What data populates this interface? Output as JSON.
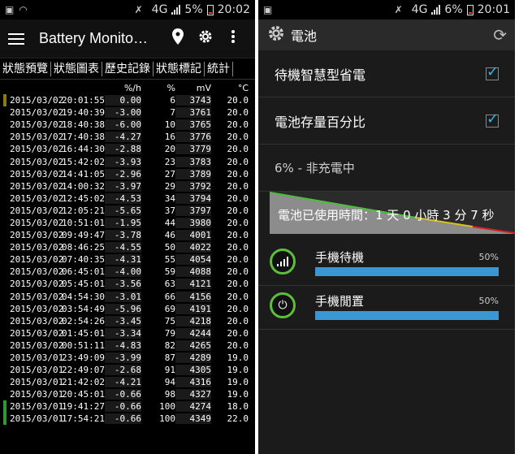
{
  "left": {
    "status": {
      "network": "4G",
      "battery": "5%",
      "time": "20:02"
    },
    "toolbar": {
      "title": "Battery Monito…"
    },
    "tabs": [
      "狀態預覽",
      "狀態圖表",
      "歷史記錄",
      "狀態標記",
      "統計"
    ],
    "columns": {
      "rate": "%/h",
      "pct": "%",
      "mv": "mV",
      "temp": "°C"
    },
    "rows": [
      {
        "date": "2015/03/02",
        "time": "20:01:55",
        "rate": "0.00",
        "pct": "6",
        "mv": "3743",
        "temp": "20.0",
        "mark": "#8a7a10"
      },
      {
        "date": "2015/03/02",
        "time": "19:40:39",
        "rate": "-3.00",
        "pct": "7",
        "mv": "3761",
        "temp": "20.0"
      },
      {
        "date": "2015/03/02",
        "time": "18:40:38",
        "rate": "-6.00",
        "pct": "10",
        "mv": "3765",
        "temp": "20.0"
      },
      {
        "date": "2015/03/02",
        "time": "17:40:38",
        "rate": "-4.27",
        "pct": "16",
        "mv": "3776",
        "temp": "20.0"
      },
      {
        "date": "2015/03/02",
        "time": "16:44:30",
        "rate": "-2.88",
        "pct": "20",
        "mv": "3779",
        "temp": "20.0"
      },
      {
        "date": "2015/03/02",
        "time": "15:42:02",
        "rate": "-3.93",
        "pct": "23",
        "mv": "3783",
        "temp": "20.0"
      },
      {
        "date": "2015/03/02",
        "time": "14:41:05",
        "rate": "-2.96",
        "pct": "27",
        "mv": "3789",
        "temp": "20.0"
      },
      {
        "date": "2015/03/02",
        "time": "14:00:32",
        "rate": "-3.97",
        "pct": "29",
        "mv": "3792",
        "temp": "20.0"
      },
      {
        "date": "2015/03/02",
        "time": "12:45:02",
        "rate": "-4.53",
        "pct": "34",
        "mv": "3794",
        "temp": "20.0"
      },
      {
        "date": "2015/03/02",
        "time": "12:05:21",
        "rate": "-5.65",
        "pct": "37",
        "mv": "3797",
        "temp": "20.0"
      },
      {
        "date": "2015/03/02",
        "time": "10:51:01",
        "rate": "-1.95",
        "pct": "44",
        "mv": "3980",
        "temp": "20.0"
      },
      {
        "date": "2015/03/02",
        "time": "09:49:47",
        "rate": "-3.78",
        "pct": "46",
        "mv": "4001",
        "temp": "20.0"
      },
      {
        "date": "2015/03/02",
        "time": "08:46:25",
        "rate": "-4.55",
        "pct": "50",
        "mv": "4022",
        "temp": "20.0"
      },
      {
        "date": "2015/03/02",
        "time": "07:40:35",
        "rate": "-4.31",
        "pct": "55",
        "mv": "4054",
        "temp": "20.0"
      },
      {
        "date": "2015/03/02",
        "time": "06:45:01",
        "rate": "-4.00",
        "pct": "59",
        "mv": "4088",
        "temp": "20.0"
      },
      {
        "date": "2015/03/02",
        "time": "05:45:01",
        "rate": "-3.56",
        "pct": "63",
        "mv": "4121",
        "temp": "20.0"
      },
      {
        "date": "2015/03/02",
        "time": "04:54:30",
        "rate": "-3.01",
        "pct": "66",
        "mv": "4156",
        "temp": "20.0"
      },
      {
        "date": "2015/03/02",
        "time": "03:54:49",
        "rate": "-5.96",
        "pct": "69",
        "mv": "4191",
        "temp": "20.0"
      },
      {
        "date": "2015/03/02",
        "time": "02:54:26",
        "rate": "-3.45",
        "pct": "75",
        "mv": "4218",
        "temp": "20.0"
      },
      {
        "date": "2015/03/02",
        "time": "01:45:01",
        "rate": "-3.34",
        "pct": "79",
        "mv": "4244",
        "temp": "20.0"
      },
      {
        "date": "2015/03/02",
        "time": "00:51:11",
        "rate": "-4.83",
        "pct": "82",
        "mv": "4265",
        "temp": "20.0"
      },
      {
        "date": "2015/03/01",
        "time": "23:49:09",
        "rate": "-3.99",
        "pct": "87",
        "mv": "4289",
        "temp": "19.0"
      },
      {
        "date": "2015/03/01",
        "time": "22:49:07",
        "rate": "-2.68",
        "pct": "91",
        "mv": "4305",
        "temp": "19.0"
      },
      {
        "date": "2015/03/01",
        "time": "21:42:02",
        "rate": "-4.21",
        "pct": "94",
        "mv": "4316",
        "temp": "19.0"
      },
      {
        "date": "2015/03/01",
        "time": "20:45:01",
        "rate": "-0.66",
        "pct": "98",
        "mv": "4327",
        "temp": "19.0"
      },
      {
        "date": "2015/03/01",
        "time": "19:41:27",
        "rate": "-0.66",
        "pct": "100",
        "mv": "4274",
        "temp": "18.0",
        "mark": "#2c9a2c"
      },
      {
        "date": "2015/03/01",
        "time": "17:54:21",
        "rate": "-0.66",
        "pct": "100",
        "mv": "4349",
        "temp": "22.0",
        "mark": "#2c9a2c"
      }
    ]
  },
  "right": {
    "status": {
      "network": "4G",
      "battery": "6%",
      "time": "20:01"
    },
    "toolbar": {
      "title": "電池"
    },
    "settings": [
      {
        "label": "待機智慧型省電",
        "checked": true
      },
      {
        "label": "電池存量百分比",
        "checked": true
      }
    ],
    "status_text": "6% - 非充電中",
    "usage_time": "電池已使用時間：1 天 0 小時 3 分 7 秒",
    "usage_items": [
      {
        "name": "手機待機",
        "percent": "50%",
        "icon": "signal-icon"
      },
      {
        "name": "手機閒置",
        "percent": "50%",
        "icon": "power-icon"
      }
    ],
    "usage_level": 0.5
  }
}
